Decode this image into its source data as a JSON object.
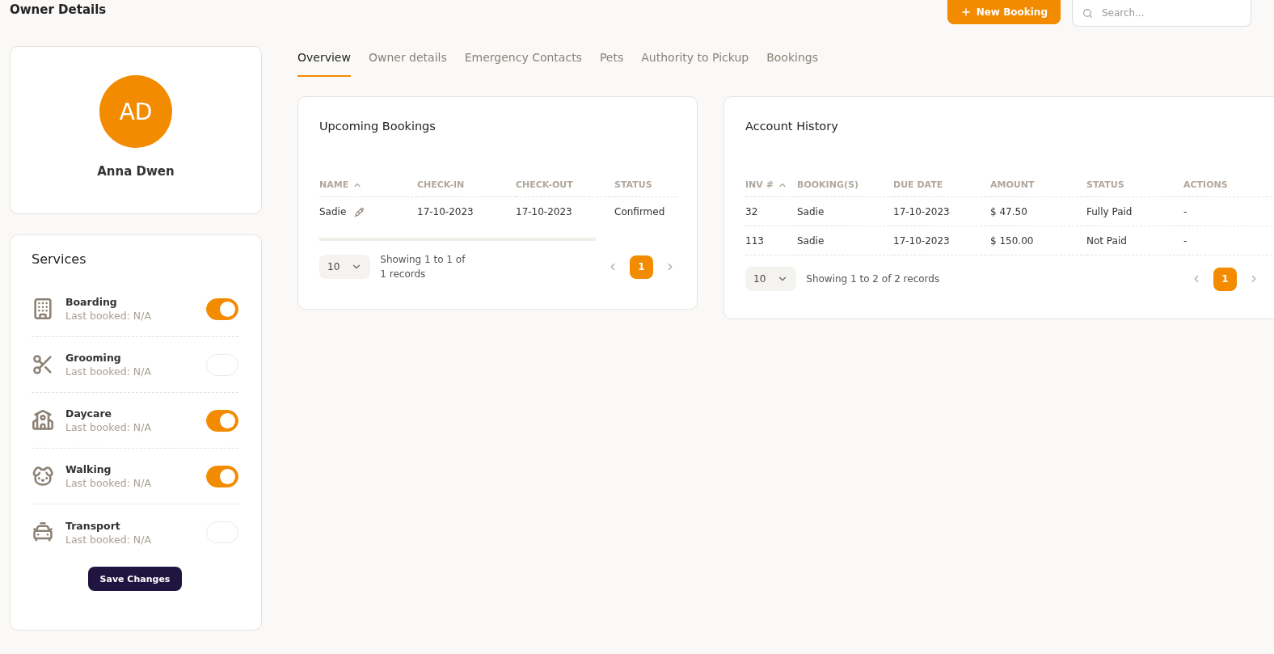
{
  "page_title": "Owner Details",
  "header": {
    "new_button": "New Booking",
    "search": {
      "placeholder": "Search..."
    }
  },
  "profile": {
    "initials": "AD",
    "name": "Anna Dwen"
  },
  "services": {
    "title": "Services",
    "items": [
      {
        "kind": "building",
        "name": "Boarding",
        "last": "Last booked: N/A",
        "on": true
      },
      {
        "kind": "scissors",
        "name": "Grooming",
        "last": "Last booked: N/A",
        "on": false
      },
      {
        "kind": "school",
        "name": "Daycare",
        "last": "Last booked: N/A",
        "on": true
      },
      {
        "kind": "dog",
        "name": "Walking",
        "last": "Last booked: N/A",
        "on": true
      },
      {
        "kind": "taxi",
        "name": "Transport",
        "last": "Last booked: N/A",
        "on": false
      }
    ],
    "save_button": "Save Changes"
  },
  "tabs": [
    {
      "label": "Overview",
      "selected": true
    },
    {
      "label": "Owner details",
      "selected": false
    },
    {
      "label": "Emergency Contacts",
      "selected": false
    },
    {
      "label": "Pets",
      "selected": false
    },
    {
      "label": "Authority to Pickup",
      "selected": false
    },
    {
      "label": "Bookings",
      "selected": false
    }
  ],
  "upcoming": {
    "title": "Upcoming Bookings",
    "columns": [
      {
        "label": "NAME",
        "sorted": true
      },
      {
        "label": "CHECK-IN",
        "sorted": false
      },
      {
        "label": "CHECK-OUT",
        "sorted": false
      },
      {
        "label": "STATUS",
        "sorted": false
      }
    ],
    "rows": [
      {
        "cells": [
          "Sadie",
          "17-10-2023",
          "17-10-2023",
          "Confirmed"
        ],
        "vaccine": true
      }
    ],
    "page_size": "10",
    "showing": "Showing 1 to 1 of 1 records",
    "pages": [
      {
        "label": "1",
        "selected": true
      }
    ]
  },
  "account": {
    "title": "Account History",
    "columns": [
      {
        "label": "INV #",
        "sorted": true
      },
      {
        "label": "BOOKING(S)",
        "sorted": false
      },
      {
        "label": "DUE DATE",
        "sorted": false
      },
      {
        "label": "AMOUNT",
        "sorted": false
      },
      {
        "label": "STATUS",
        "sorted": false
      },
      {
        "label": "ACTIONS",
        "sorted": false
      }
    ],
    "rows": [
      {
        "cells": [
          "32",
          "Sadie",
          "17-10-2023",
          "$ 47.50",
          "Fully Paid",
          "-"
        ]
      },
      {
        "cells": [
          "113",
          "Sadie",
          "17-10-2023",
          "$ 150.00",
          "Not Paid",
          "-"
        ]
      }
    ],
    "page_size": "10",
    "showing": "Showing 1 to 2 of 2 records",
    "pages": [
      {
        "label": "1",
        "selected": true
      }
    ]
  }
}
